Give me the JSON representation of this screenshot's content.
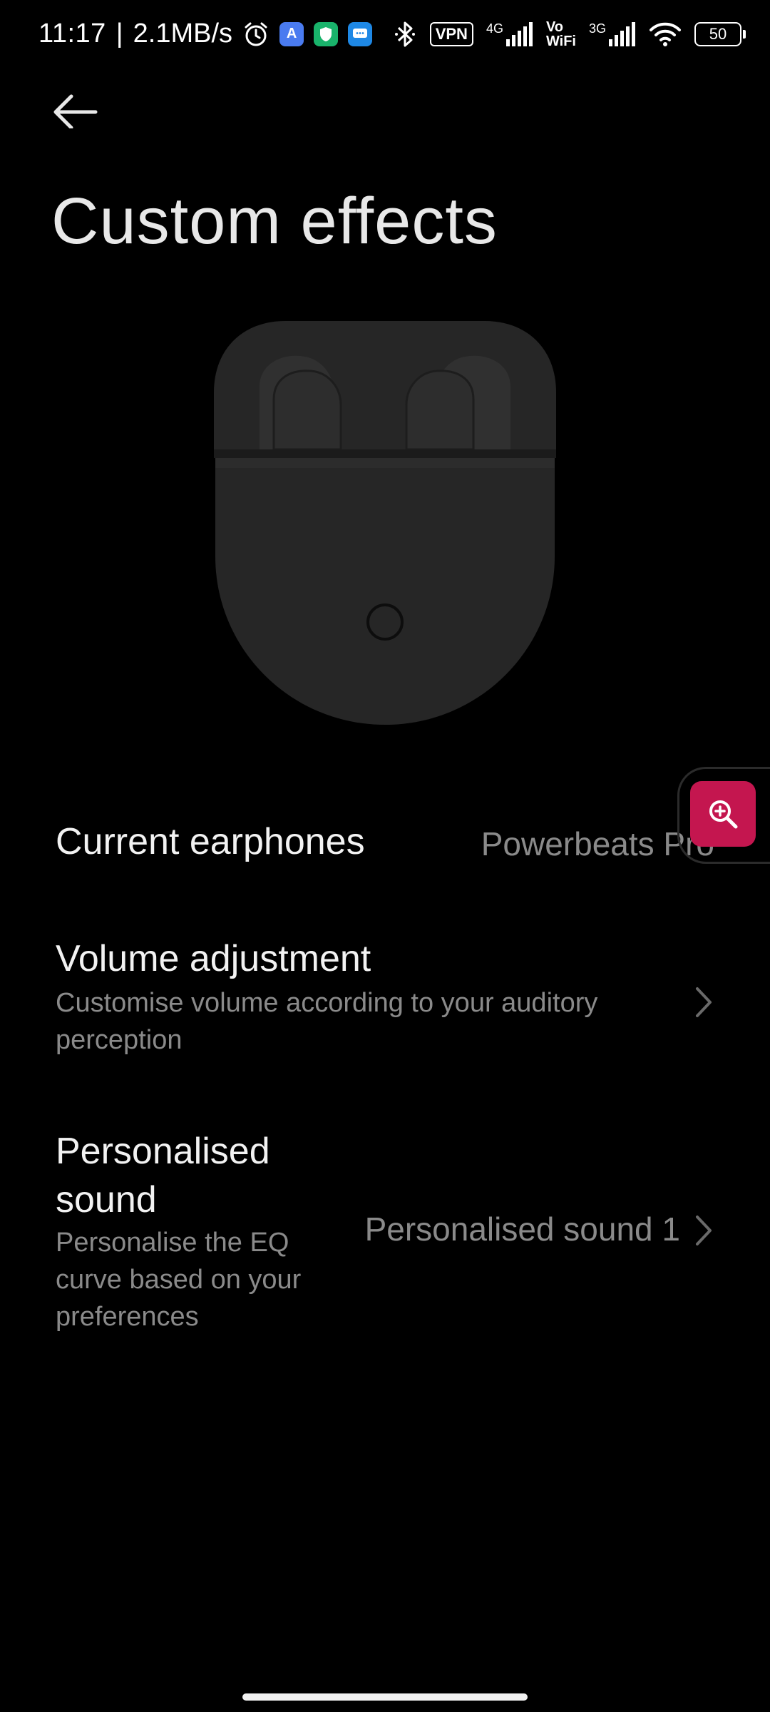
{
  "status_bar": {
    "time": "11:17",
    "separator": "|",
    "net_speed": "2.1MB/s",
    "vpn": "VPN",
    "net1": "4G",
    "volte_top": "Vo",
    "volte_bottom": "WiFi",
    "net2": "3G",
    "battery": "50"
  },
  "header": {
    "title": "Custom effects"
  },
  "current_earphones": {
    "label": "Current earphones",
    "value": "Powerbeats Pro"
  },
  "volume_adjustment": {
    "label": "Volume adjustment",
    "description": "Customise volume according to your auditory perception"
  },
  "personalised_sound": {
    "label_line1": "Personalised",
    "label_line2": "sound",
    "description_line1": "Personalise the EQ",
    "description_line2": "curve based on your",
    "description_line3": "preferences",
    "value": "Personalised sound 1"
  },
  "colors": {
    "background": "#000000",
    "accent": "#c4164f",
    "secondary_text": "#8a8a8a"
  },
  "icons": [
    "back-arrow-icon",
    "alarm-icon",
    "bluetooth-icon",
    "wifi-icon",
    "signal-icon",
    "zoom-in-icon",
    "chevron-right-icon"
  ]
}
